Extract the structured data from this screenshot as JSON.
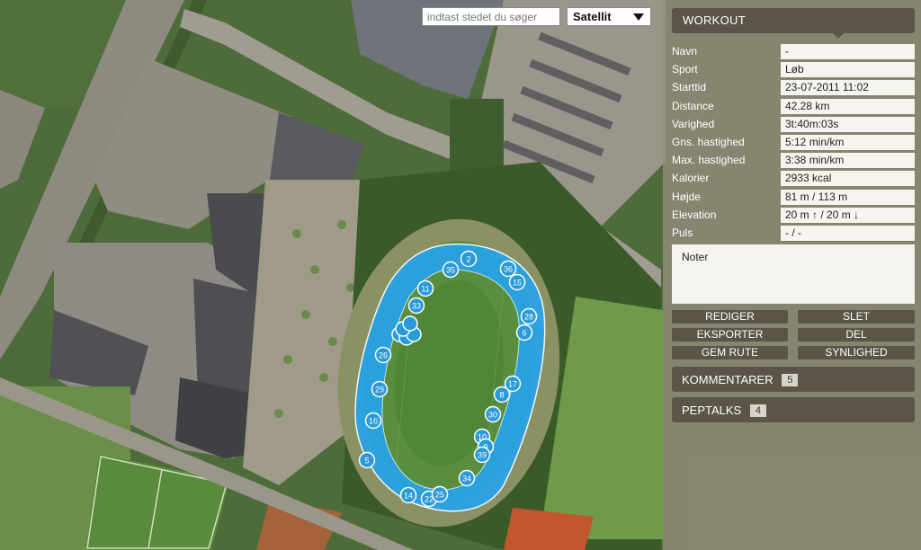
{
  "search": {
    "placeholder": "indtast stedet du søger"
  },
  "map_type": {
    "selected": "Satellit"
  },
  "workout": {
    "title": "WORKOUT",
    "fields": [
      {
        "label": "Navn",
        "value": "-"
      },
      {
        "label": "Sport",
        "value": "Løb"
      },
      {
        "label": "Starttid",
        "value": "23-07-2011 11:02"
      },
      {
        "label": "Distance",
        "value": "42.28 km"
      },
      {
        "label": "Varighed",
        "value": "3t:40m:03s"
      },
      {
        "label": "Gns. hastighed",
        "value": "5:12 min/km"
      },
      {
        "label": "Max. hastighed",
        "value": "3:38 min/km"
      },
      {
        "label": "Kalorier",
        "value": "2933 kcal"
      },
      {
        "label": "Højde",
        "value": "81 m / 113 m"
      },
      {
        "label": "Elevation",
        "value": "20 m ↑ / 20 m ↓"
      },
      {
        "label": "Puls",
        "value": "- / -"
      }
    ],
    "notes_label": "Noter"
  },
  "buttons": {
    "edit": "REDIGER",
    "delete": "SLET",
    "export": "EKSPORTER",
    "share": "DEL",
    "save_route": "GEM RUTE",
    "visibility": "SYNLIGHED"
  },
  "comments": {
    "label": "KOMMENTARER",
    "count": "5"
  },
  "peptalks": {
    "label": "PEPTALKS",
    "count": "4"
  },
  "route_markers": [
    "2",
    "35",
    "36",
    "15",
    "11",
    "33",
    "28",
    "6",
    "26",
    "29",
    "17",
    "8",
    "30",
    "16",
    "10",
    "9",
    "39",
    "34",
    "5",
    "14",
    "22",
    "25"
  ]
}
